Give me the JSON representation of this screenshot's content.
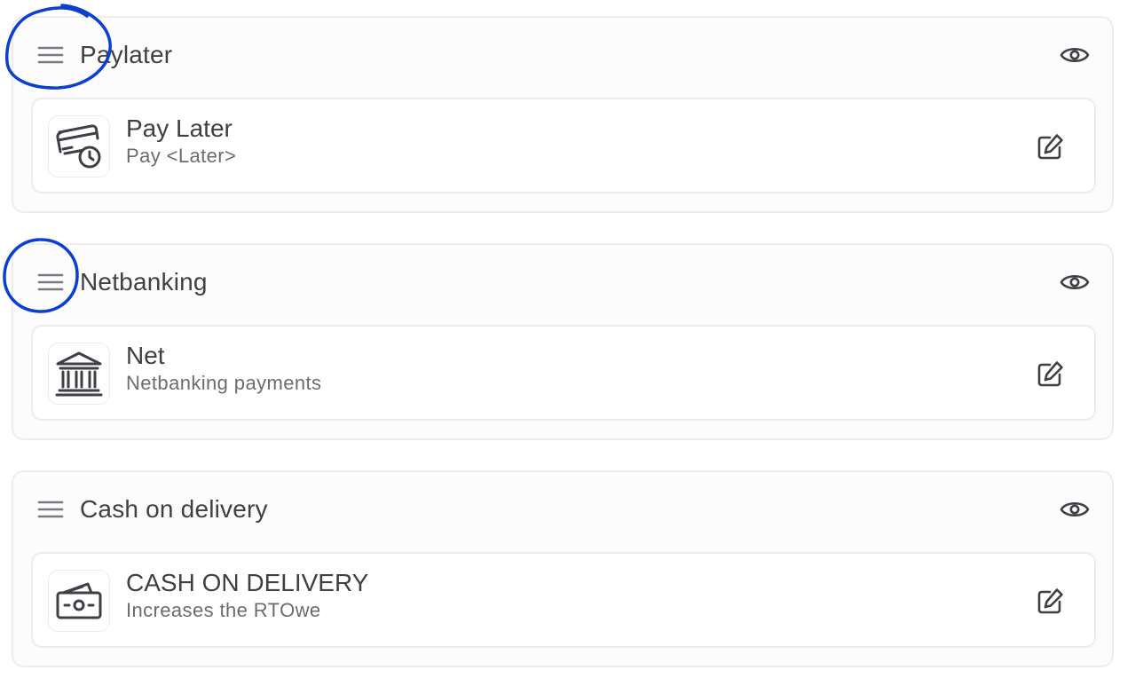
{
  "groups": [
    {
      "title": "Paylater",
      "method": {
        "name": "Pay Later",
        "description": "Pay <Later>",
        "icon": "card-clock-icon"
      }
    },
    {
      "title": "Netbanking",
      "method": {
        "name": "Net",
        "description": "Netbanking payments",
        "icon": "bank-icon"
      }
    },
    {
      "title": "Cash on delivery",
      "method": {
        "name": "CASH ON DELIVERY",
        "description": "Increases the RTOwe",
        "icon": "cash-icon"
      }
    }
  ],
  "icons": {
    "drag": "drag-handle-icon",
    "visibility": "eye-icon",
    "edit": "edit-icon"
  },
  "colors": {
    "text": "#3f3f46",
    "muted": "#6b6b73",
    "icon": "#7a7a82",
    "border": "#ececef",
    "annotation": "#0b3fd1"
  }
}
